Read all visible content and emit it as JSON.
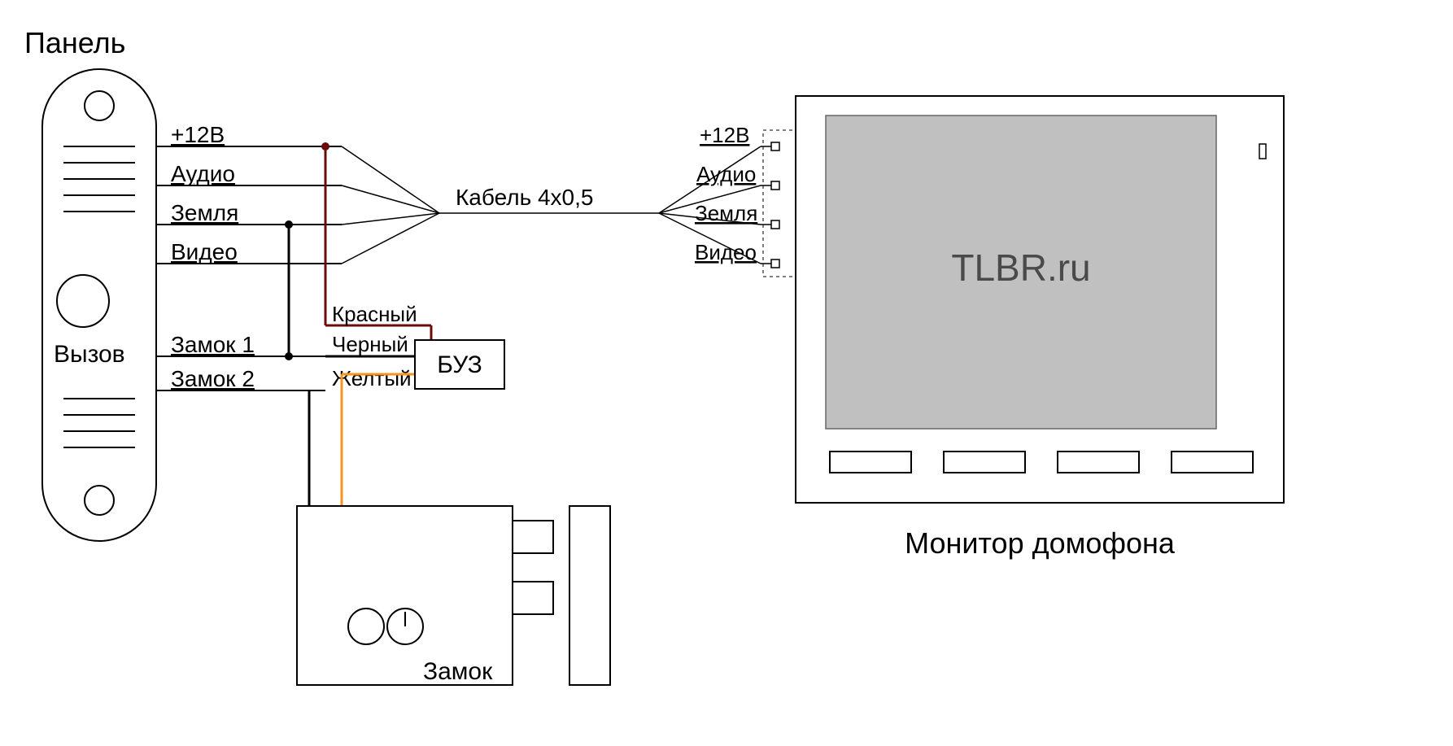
{
  "panel": {
    "title": "Панель",
    "call_button": "Вызов",
    "wires_right": [
      "+12В",
      "Аудио",
      "Земля",
      "Видео",
      "Замок 1",
      "Замок 2"
    ]
  },
  "cable": {
    "label": "Кабель 4х0,5"
  },
  "monitor": {
    "title": "Монитор домофона",
    "screen_text": "TLBR.ru",
    "terminals": [
      "+12В",
      "Аудио",
      "Земля",
      "Видео"
    ]
  },
  "buz": {
    "label": "БУЗ",
    "wire_red": "Красный",
    "wire_black": "Черный",
    "wire_yellow": "Желтый"
  },
  "lock": {
    "label": "Замок"
  },
  "colors": {
    "red": "#6b0c0c",
    "black": "#000000",
    "orange": "#f7941e"
  }
}
